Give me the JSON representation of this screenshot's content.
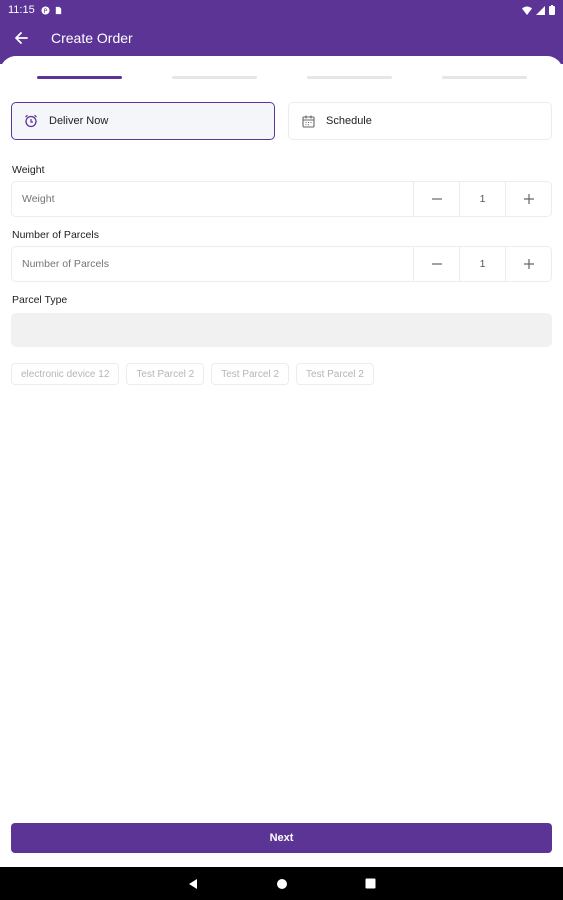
{
  "status_bar": {
    "time": "11:15"
  },
  "app_bar": {
    "title": "Create Order",
    "back_icon": "arrow-left-icon"
  },
  "progress": {
    "total_steps": 4,
    "active_step": 1
  },
  "delivery_mode": {
    "options": [
      {
        "label": "Deliver Now",
        "icon": "alarm-clock-icon",
        "selected": true
      },
      {
        "label": "Schedule",
        "icon": "calendar-icon",
        "selected": false
      }
    ]
  },
  "weight": {
    "label": "Weight",
    "placeholder": "Weight",
    "value": "1"
  },
  "parcels": {
    "label": "Number of Parcels",
    "placeholder": "Number of Parcels",
    "value": "1"
  },
  "parcel_type": {
    "label": "Parcel Type",
    "selected": "",
    "chips": [
      "electronic device 12",
      "Test Parcel 2",
      "Test Parcel 2",
      "Test Parcel 2"
    ]
  },
  "footer": {
    "next_label": "Next"
  },
  "colors": {
    "brand": "#5b3496"
  }
}
